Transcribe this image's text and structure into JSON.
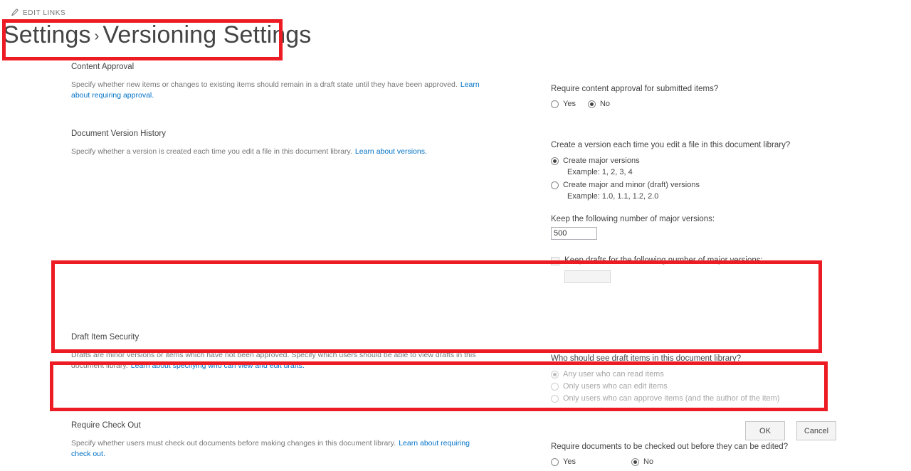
{
  "topbar": {
    "edit_links_label": "EDIT LINKS",
    "pencil_icon": "pencil-icon"
  },
  "header": {
    "breadcrumb_parent": "Settings",
    "separator": "›",
    "title": "Versioning Settings"
  },
  "sections": {
    "content_approval": {
      "heading": "Content Approval",
      "description": "Specify whether new items or changes to existing items should remain in a draft state until they have been approved.",
      "link": "Learn about requiring approval.",
      "question": "Require content approval for submitted items?",
      "options": [
        {
          "label": "Yes",
          "selected": false
        },
        {
          "label": "No",
          "selected": true
        }
      ]
    },
    "version_history": {
      "heading": "Document Version History",
      "description": "Specify whether a version is created each time you edit a file in this document library.",
      "link": "Learn about versions.",
      "question": "Create a version each time you edit a file in this document library?",
      "major_option": "Create major versions",
      "major_example": "Example: 1, 2, 3, 4",
      "minor_option": "Create major and minor (draft) versions",
      "minor_example": "Example: 1.0, 1.1, 1.2, 2.0",
      "keep_major_label": "Keep the following number of major versions:",
      "keep_major_value": "500",
      "keep_drafts_label": "Keep drafts for the following number of major versions:",
      "keep_drafts_checked": false,
      "keep_drafts_value": ""
    },
    "draft_security": {
      "heading": "Draft Item Security",
      "description": "Drafts are minor versions or items which have not been approved. Specify which users should be able to view drafts in this document library.",
      "link": "Learn about specifying who can view and edit drafts.",
      "question": "Who should see draft items in this document library?",
      "options": [
        {
          "label": "Any user who can read items",
          "selected": true
        },
        {
          "label": "Only users who can edit items",
          "selected": false
        },
        {
          "label": "Only users who can approve items (and the author of the item)",
          "selected": false
        }
      ]
    },
    "require_checkout": {
      "heading": "Require Check Out",
      "description": "Specify whether users must check out documents before making changes in this document library.",
      "link": "Learn about requiring check out.",
      "question": "Require documents to be checked out before they can be edited?",
      "options": [
        {
          "label": "Yes",
          "selected": false
        },
        {
          "label": "No",
          "selected": true
        }
      ]
    }
  },
  "buttons": {
    "ok": "OK",
    "cancel": "Cancel"
  },
  "annotations": {
    "accent_color": "#ed1c24",
    "boxes": [
      {
        "name": "title-highlight"
      },
      {
        "name": "draft-item-security-highlight"
      },
      {
        "name": "require-check-out-highlight"
      }
    ]
  }
}
